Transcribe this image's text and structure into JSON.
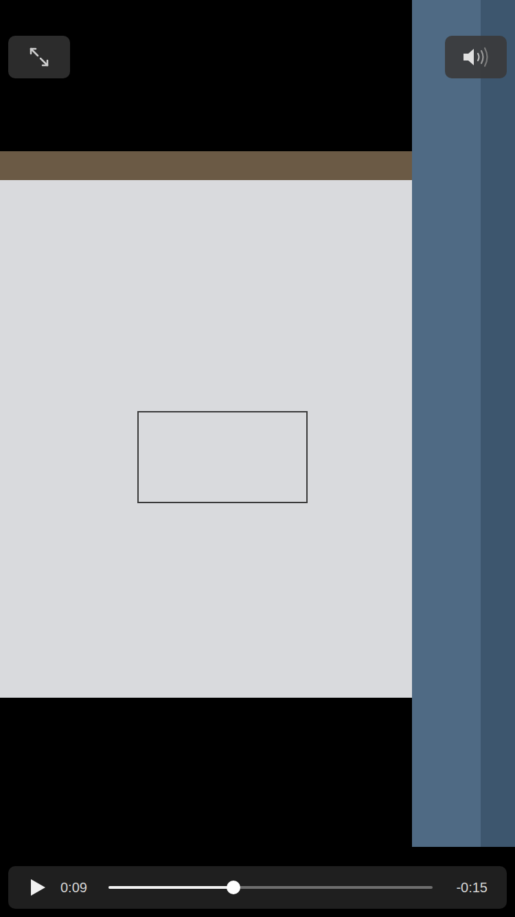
{
  "player": {
    "elapsed": "0:09",
    "remaining": "-0:15",
    "progress": 0.385,
    "playing": false
  }
}
